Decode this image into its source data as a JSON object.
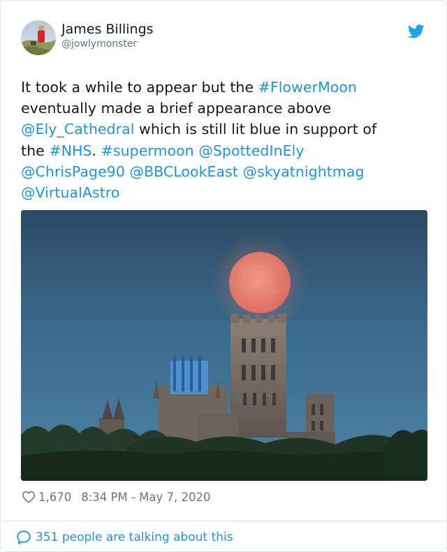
{
  "author": {
    "name": "James Billings",
    "handle": "@jowlymonster"
  },
  "tweet": {
    "lines": [
      [
        {
          "text": "It took a while to appear but the ",
          "link": false
        },
        {
          "text": "#FlowerMoon",
          "link": true
        }
      ],
      [
        {
          "text": "eventually made a brief appearance above",
          "link": false
        }
      ],
      [
        {
          "text": "@Ely_Cathedral",
          "link": true
        },
        {
          "text": " which is still lit blue in support of",
          "link": false
        }
      ],
      [
        {
          "text": "the ",
          "link": false
        },
        {
          "text": "#NHS",
          "link": true
        },
        {
          "text": ". ",
          "link": false
        },
        {
          "text": "#supermoon",
          "link": true
        },
        {
          "text": " ",
          "link": false
        },
        {
          "text": "@SpottedInEly",
          "link": true
        }
      ],
      [
        {
          "text": "@ChrisPage90",
          "link": true
        },
        {
          "text": " ",
          "link": false
        },
        {
          "text": "@BBCLookEast",
          "link": true
        },
        {
          "text": " ",
          "link": false
        },
        {
          "text": "@skyatnightmag",
          "link": true
        }
      ],
      [
        {
          "text": "@VirtualAstro",
          "link": true
        }
      ]
    ]
  },
  "stats": {
    "likes": "1,670",
    "timestamp": "8:34 PM - May 7, 2020"
  },
  "conversation": {
    "label": "351 people are talking about this"
  },
  "icons": {
    "brand": "twitter-bird-icon",
    "like": "heart-icon",
    "reply": "speech-bubble-icon"
  },
  "colors": {
    "link": "#1b95e0",
    "text": "#14171a",
    "muted": "#657786",
    "border": "#e1e8ed"
  }
}
